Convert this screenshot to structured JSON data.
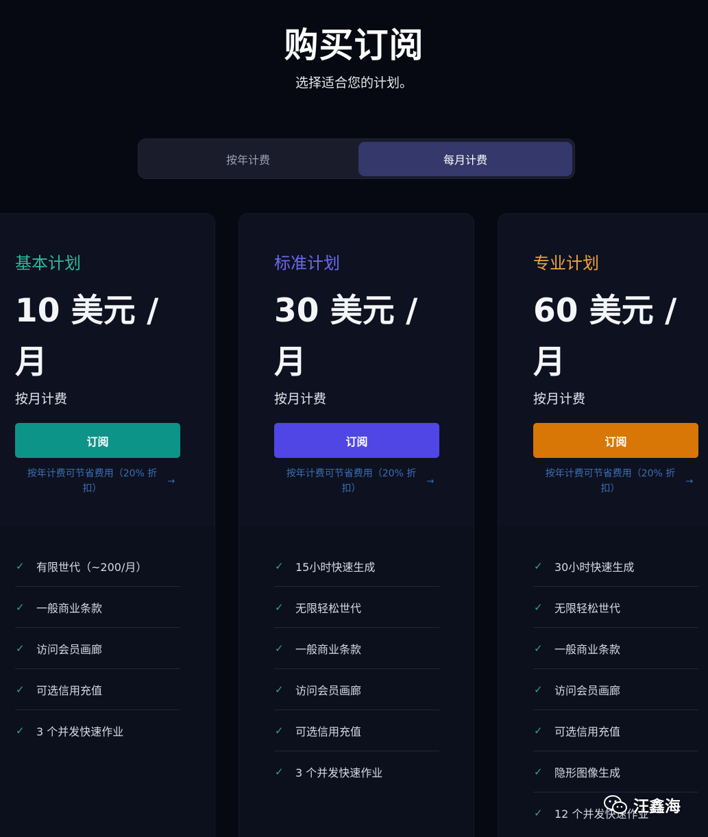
{
  "header": {
    "title": "购买订阅",
    "subtitle": "选择适合您的计划。"
  },
  "billing_toggle": {
    "yearly_label": "按年计费",
    "monthly_label": "每月计费",
    "selected": "monthly"
  },
  "plans": [
    {
      "name": "基本计划",
      "price": "10 美元 / 月",
      "period": "按月计费",
      "button_label": "订阅",
      "save_text": "按年计费可节省费用（20% 折扣）",
      "accent_color": "#2fb89a",
      "button_color": "#0d9488",
      "features": [
        "有限世代（~200/月）",
        "一般商业条款",
        "访问会员画廊",
        "可选信用充值",
        "3 个并发快速作业"
      ]
    },
    {
      "name": "标准计划",
      "price": "30 美元 / 月",
      "period": "按月计费",
      "button_label": "订阅",
      "save_text": "按年计费可节省费用（20% 折扣）",
      "accent_color": "#6b6bf0",
      "button_color": "#4f46e5",
      "features": [
        "15小时快速生成",
        "无限轻松世代",
        "一般商业条款",
        "访问会员画廊",
        "可选信用充值",
        "3 个并发快速作业"
      ]
    },
    {
      "name": "专业计划",
      "price": "60 美元 / 月",
      "period": "按月计费",
      "button_label": "订阅",
      "save_text": "按年计费可节省费用（20% 折扣）",
      "accent_color": "#f0a53a",
      "button_color": "#d97706",
      "features": [
        "30小时快速生成",
        "无限轻松世代",
        "一般商业条款",
        "访问会员画廊",
        "可选信用充值",
        "隐形图像生成",
        "12 个并发快速作业"
      ]
    }
  ],
  "watermark": {
    "text": "汪鑫海",
    "icon": "wechat-icon"
  }
}
